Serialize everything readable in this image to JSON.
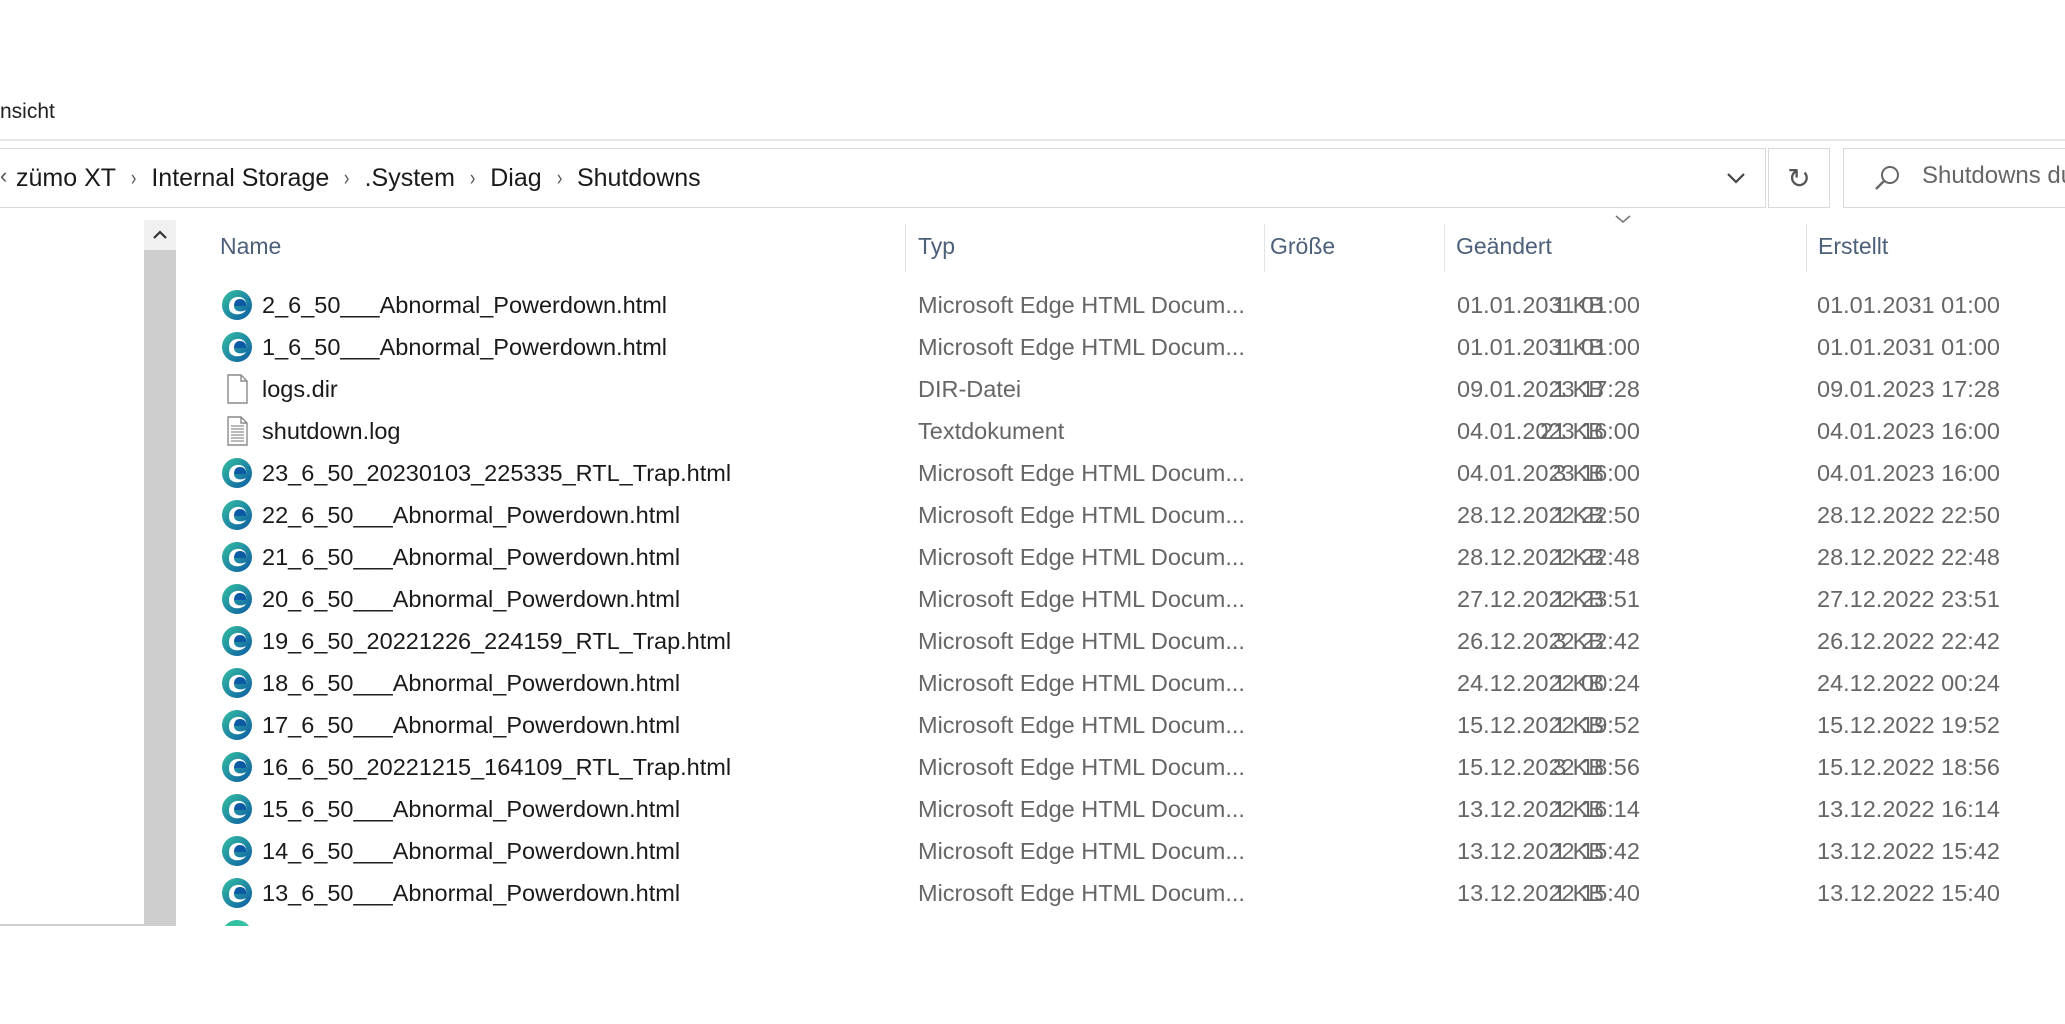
{
  "ribbon": {
    "tab_partial": "nsicht"
  },
  "address": {
    "lead": "‹",
    "crumbs": [
      {
        "label": "zümo XT"
      },
      {
        "label": "Internal Storage"
      },
      {
        "label": ".System"
      },
      {
        "label": "Diag"
      },
      {
        "label": "Shutdowns"
      }
    ],
    "separator": "›"
  },
  "refresh_glyph": "↻",
  "search": {
    "value": "Shutdowns du"
  },
  "columns": {
    "name": "Name",
    "type": "Typ",
    "size": "Größe",
    "modified": "Geändert",
    "created": "Erstellt"
  },
  "files": [
    {
      "name": "2_6_50___Abnormal_Powerdown.html",
      "type": "Microsoft Edge HTML Docum...",
      "size": "1 KB",
      "modified": "01.01.2031 01:00",
      "created": "01.01.2031 01:00",
      "icon": "edge-icon"
    },
    {
      "name": "1_6_50___Abnormal_Powerdown.html",
      "type": "Microsoft Edge HTML Docum...",
      "size": "1 KB",
      "modified": "01.01.2031 01:00",
      "created": "01.01.2031 01:00",
      "icon": "edge-icon"
    },
    {
      "name": "logs.dir",
      "type": "DIR-Datei",
      "size": "1 KB",
      "modified": "09.01.2023 17:28",
      "created": "09.01.2023 17:28",
      "icon": "blank-file-icon"
    },
    {
      "name": "shutdown.log",
      "type": "Textdokument",
      "size": "21 KB",
      "modified": "04.01.2023 16:00",
      "created": "04.01.2023 16:00",
      "icon": "text-file-icon"
    },
    {
      "name": "23_6_50_20230103_225335_RTL_Trap.html",
      "type": "Microsoft Edge HTML Docum...",
      "size": "3 KB",
      "modified": "04.01.2023 16:00",
      "created": "04.01.2023 16:00",
      "icon": "edge-icon"
    },
    {
      "name": "22_6_50___Abnormal_Powerdown.html",
      "type": "Microsoft Edge HTML Docum...",
      "size": "1 KB",
      "modified": "28.12.2022 22:50",
      "created": "28.12.2022 22:50",
      "icon": "edge-icon"
    },
    {
      "name": "21_6_50___Abnormal_Powerdown.html",
      "type": "Microsoft Edge HTML Docum...",
      "size": "1 KB",
      "modified": "28.12.2022 22:48",
      "created": "28.12.2022 22:48",
      "icon": "edge-icon"
    },
    {
      "name": "20_6_50___Abnormal_Powerdown.html",
      "type": "Microsoft Edge HTML Docum...",
      "size": "1 KB",
      "modified": "27.12.2022 23:51",
      "created": "27.12.2022 23:51",
      "icon": "edge-icon"
    },
    {
      "name": "19_6_50_20221226_224159_RTL_Trap.html",
      "type": "Microsoft Edge HTML Docum...",
      "size": "3 KB",
      "modified": "26.12.2022 22:42",
      "created": "26.12.2022 22:42",
      "icon": "edge-icon"
    },
    {
      "name": "18_6_50___Abnormal_Powerdown.html",
      "type": "Microsoft Edge HTML Docum...",
      "size": "1 KB",
      "modified": "24.12.2022 00:24",
      "created": "24.12.2022 00:24",
      "icon": "edge-icon"
    },
    {
      "name": "17_6_50___Abnormal_Powerdown.html",
      "type": "Microsoft Edge HTML Docum...",
      "size": "1 KB",
      "modified": "15.12.2022 19:52",
      "created": "15.12.2022 19:52",
      "icon": "edge-icon"
    },
    {
      "name": "16_6_50_20221215_164109_RTL_Trap.html",
      "type": "Microsoft Edge HTML Docum...",
      "size": "3 KB",
      "modified": "15.12.2022 18:56",
      "created": "15.12.2022 18:56",
      "icon": "edge-icon"
    },
    {
      "name": "15_6_50___Abnormal_Powerdown.html",
      "type": "Microsoft Edge HTML Docum...",
      "size": "1 KB",
      "modified": "13.12.2022 16:14",
      "created": "13.12.2022 16:14",
      "icon": "edge-icon"
    },
    {
      "name": "14_6_50___Abnormal_Powerdown.html",
      "type": "Microsoft Edge HTML Docum...",
      "size": "1 KB",
      "modified": "13.12.2022 15:42",
      "created": "13.12.2022 15:42",
      "icon": "edge-icon"
    },
    {
      "name": "13_6_50___Abnormal_Powerdown.html",
      "type": "Microsoft Edge HTML Docum...",
      "size": "1 KB",
      "modified": "13.12.2022 15:40",
      "created": "13.12.2022 15:40",
      "icon": "edge-icon"
    }
  ],
  "colors": {
    "header_text": "#4c607a",
    "secondary_text": "#666666",
    "edge_blue": "#0c59a4",
    "edge_green": "#35c1a1"
  }
}
